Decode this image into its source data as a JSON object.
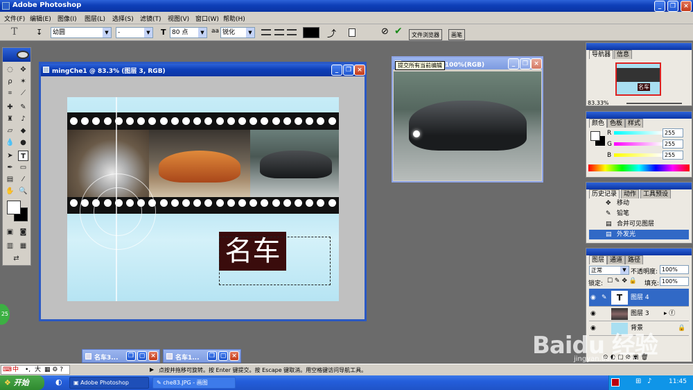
{
  "app": {
    "title": "Adobe Photoshop"
  },
  "menu": [
    "文件(F)",
    "编辑(E)",
    "图像(I)",
    "图层(L)",
    "选择(S)",
    "滤镜(T)",
    "视图(V)",
    "窗口(W)",
    "帮助(H)"
  ],
  "options": {
    "type_tool": "T",
    "font_family": "幼圆",
    "font_style": "-",
    "size_icon": "T",
    "font_size": "80 点",
    "aa_icon": "aa",
    "antialias": "锐化",
    "color": "#000000",
    "commit_tooltip": "提交所有当前编辑"
  },
  "dock_tabs": [
    "文件浏览器",
    "画笔"
  ],
  "doc1": {
    "title": "mingChe1 @ 83.3% (图层 3, RGB)",
    "text": "名车"
  },
  "doc2": {
    "title": "名车2.jpg @ 100%(RGB)"
  },
  "navigator": {
    "tabs": [
      "导航器",
      "信息"
    ],
    "zoom": "83.33%",
    "thumb_text": "名车"
  },
  "color_panel": {
    "tabs": [
      "颜色",
      "色板",
      "样式"
    ],
    "channels": [
      {
        "label": "R",
        "value": "255"
      },
      {
        "label": "G",
        "value": "255"
      },
      {
        "label": "B",
        "value": "255"
      }
    ]
  },
  "history": {
    "tabs": [
      "历史记录",
      "动作",
      "工具预设"
    ],
    "items": [
      "移动",
      "铅笔",
      "合并可见图层",
      "外发光"
    ]
  },
  "layers": {
    "tabs": [
      "图层",
      "通道",
      "路径"
    ],
    "blend_mode": "正常",
    "opacity_label": "不透明度:",
    "opacity": "100%",
    "lock_label": "锁定:",
    "fill_label": "填充:",
    "fill": "100%",
    "rows": [
      {
        "thumb": "T",
        "name": "图层 4",
        "selected": true
      },
      {
        "thumb": "",
        "name": "图层 3",
        "selected": false
      },
      {
        "thumb": "",
        "name": "背景",
        "selected": false
      }
    ]
  },
  "minimized": [
    {
      "title": "名车3..."
    },
    {
      "title": "名车1..."
    }
  ],
  "status": {
    "text": "点按并拖移可旋转。按 Enter 键提交。按 Escape 键取消。用空格键访问导航工具。"
  },
  "ime": {
    "label": "中",
    "items": [
      "中",
      "•,",
      "大"
    ]
  },
  "taskbar": {
    "start": "开始",
    "tasks": [
      "Adobe Photoshop",
      "che83.JPG - 画图"
    ],
    "clock": "11:45"
  },
  "side_circle": "25",
  "watermark": {
    "brand": "Baidu 经验",
    "url": "jingyan.baidu.com"
  }
}
